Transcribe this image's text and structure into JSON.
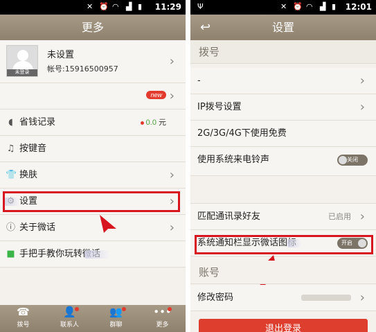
{
  "left": {
    "status_time": "11:29",
    "title": "更多",
    "profile": {
      "name": "未设置",
      "account": "帐号:15916500957",
      "avatar_caption": "未登录"
    },
    "new_badge": "new",
    "menu": [
      {
        "label": "省钱记录",
        "icon": "piggy-bank-icon"
      },
      {
        "label": "按键音",
        "icon": "music-note-icon"
      },
      {
        "label": "换肤",
        "icon": "tshirt-icon"
      },
      {
        "label": "设置",
        "icon": "gear-icon"
      },
      {
        "label": "关于微话",
        "icon": "info-icon"
      },
      {
        "label": "手把手教你玩转微话",
        "icon": "video-icon"
      }
    ],
    "money_value": "0.0",
    "money_unit": "元",
    "tabs": [
      {
        "label": "拨号",
        "icon": "phone-icon"
      },
      {
        "label": "联系人",
        "icon": "contacts-icon"
      },
      {
        "label": "群聊",
        "icon": "group-chat-icon"
      },
      {
        "label": "更多",
        "icon": "more-icon"
      }
    ]
  },
  "right": {
    "status_time": "12:01",
    "title": "设置",
    "section_dial": "拨号",
    "items": [
      {
        "label": "-"
      },
      {
        "label": "IP拨号设置"
      },
      {
        "label": "2G/3G/4G下使用免费"
      },
      {
        "label": "使用系统来电铃声",
        "toggle": "关闭"
      },
      {
        "label": "匹配通讯录好友",
        "status": "已启用"
      },
      {
        "label": "系统通知栏显示微话图标",
        "toggle": "开启"
      }
    ],
    "section_account": "账号",
    "change_password": "修改密码",
    "logout": "退出登录"
  },
  "colors": {
    "header": "#9a8d79",
    "highlight": "#d7151f",
    "badge": "#e23b2e",
    "logout": "#dd3e2d"
  }
}
